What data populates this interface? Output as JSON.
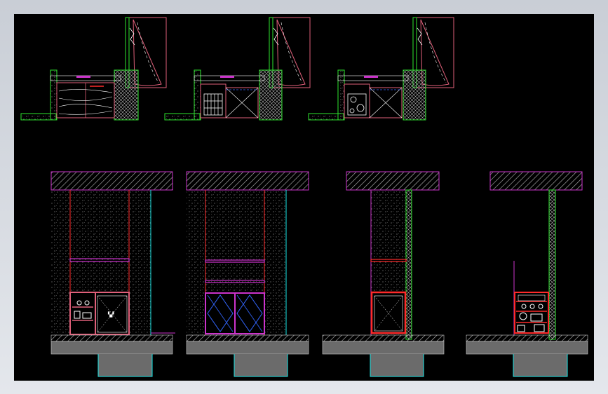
{
  "app": {
    "type": "cad-viewport",
    "background_color": "#000000",
    "frame_color": "#d4d8df"
  },
  "colors": {
    "wall_green": "#2ee62e",
    "wall_hatch": "#9a9a9a",
    "cut_pink": "#e0607a",
    "magenta": "#cc33cc",
    "red": "#ff2a2a",
    "cyan": "#19e6e6",
    "blue": "#3366ff",
    "white": "#ffffff",
    "slab_gray": "#6b6b6b",
    "floor_gray": "#8a8a8a",
    "ground_gray": "#777777"
  },
  "drawing": {
    "plans": [
      {
        "id": "plan-1",
        "unit": "wardrobe"
      },
      {
        "id": "plan-2",
        "unit": "shoe-cabinet"
      },
      {
        "id": "plan-3",
        "unit": "appliance-cabinet"
      }
    ],
    "elevations": [
      {
        "id": "elevation-1",
        "unit": "open-shelf-cabinet"
      },
      {
        "id": "elevation-2",
        "unit": "double-door-cabinet"
      },
      {
        "id": "elevation-3",
        "unit": "single-door-cabinet"
      },
      {
        "id": "elevation-4",
        "unit": "open-rack"
      }
    ]
  }
}
